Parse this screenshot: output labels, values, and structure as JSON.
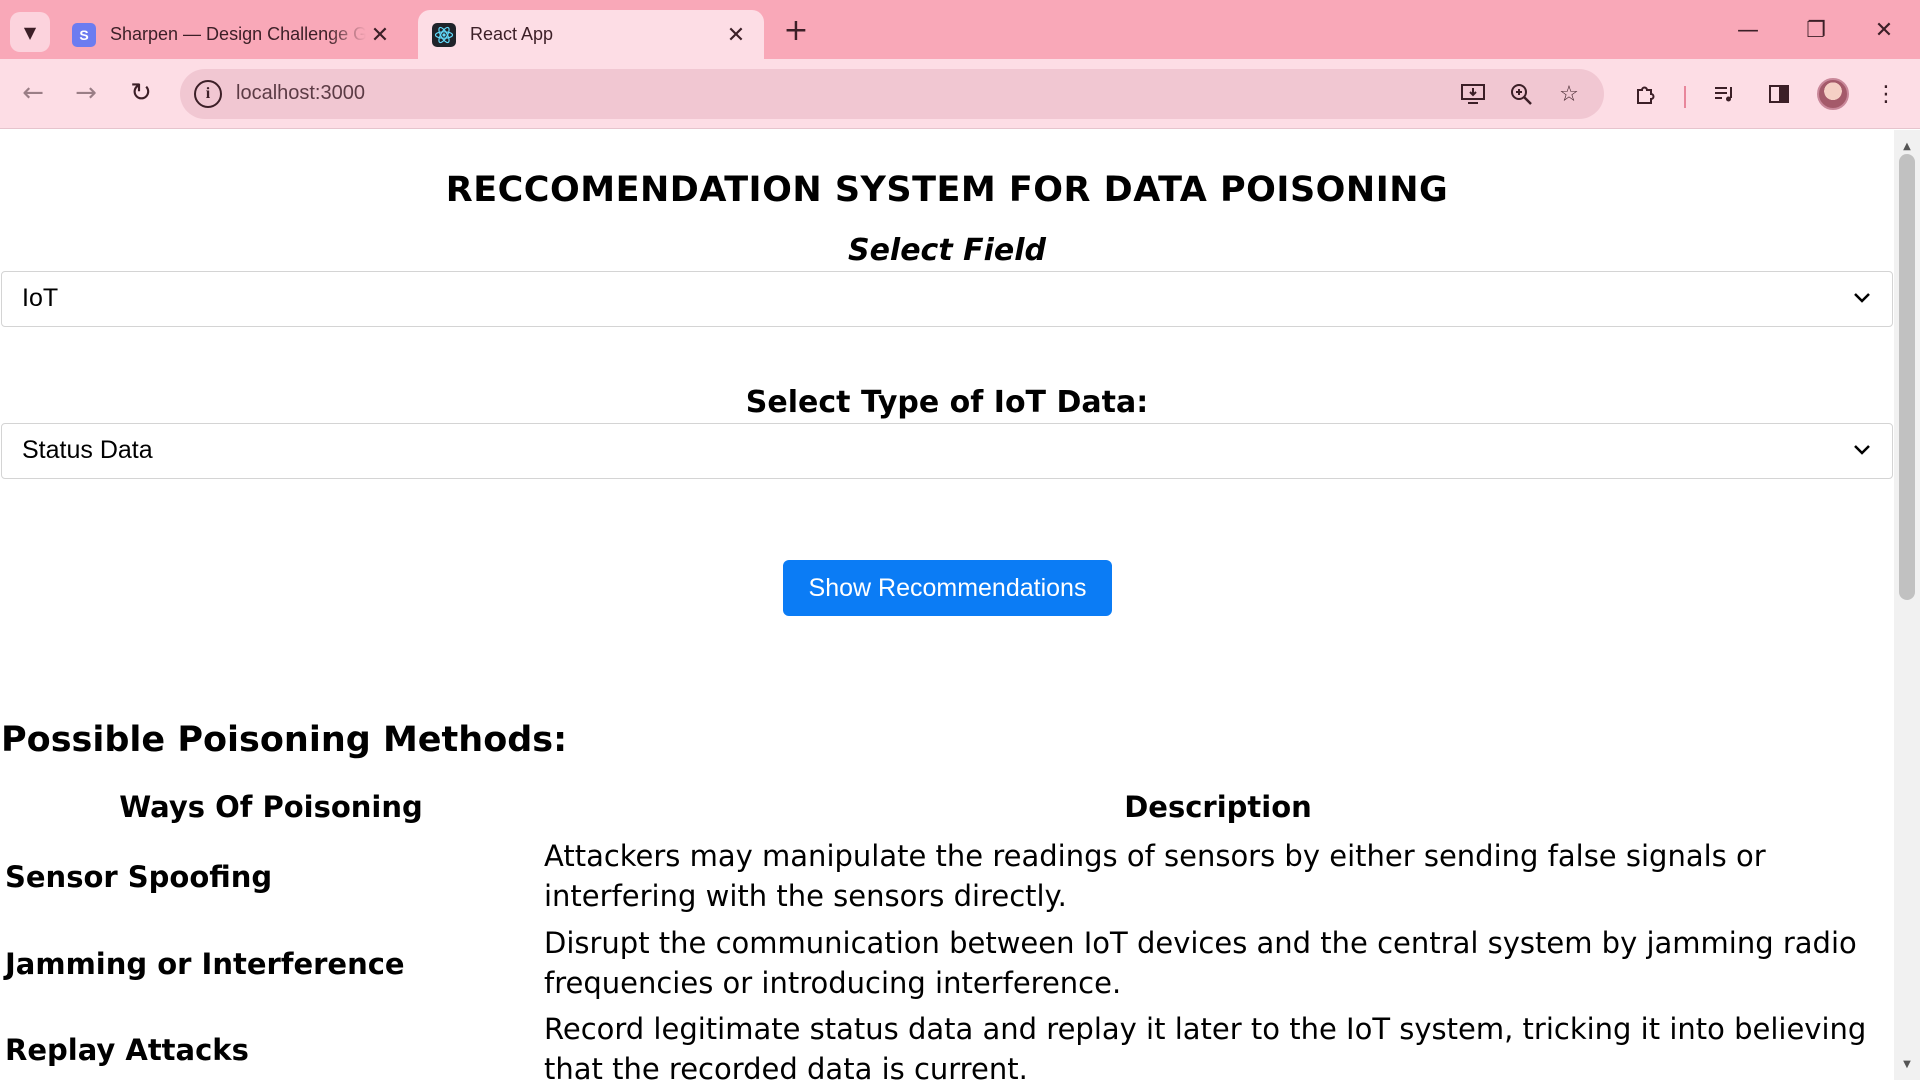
{
  "browser": {
    "tabs": [
      {
        "title": "Sharpen — Design Challenge Generator",
        "active": false
      },
      {
        "title": "React App",
        "active": true
      }
    ],
    "url": "localhost:3000"
  },
  "page": {
    "title": "RECCOMENDATION SYSTEM FOR DATA POISONING",
    "select_field_label": "Select Field",
    "field_value": "IoT",
    "type_label": "Select Type of IoT Data:",
    "type_value": "Status Data",
    "button_label": "Show Recommendations",
    "methods_heading": "Possible Poisoning Methods:",
    "table": {
      "headers": [
        "Ways Of Poisoning",
        "Description"
      ],
      "rows": [
        {
          "method": "Sensor Spoofing",
          "description": "Attackers may manipulate the readings of sensors by either sending false signals or interfering with the sensors directly."
        },
        {
          "method": "Jamming or Interference",
          "description": "Disrupt the communication between IoT devices and the central system by jamming radio frequencies or introducing interference."
        },
        {
          "method": "Replay Attacks",
          "description": "Record legitimate status data and replay it later to the IoT system, tricking it into believing that the recorded data is current."
        }
      ]
    }
  },
  "colors": {
    "tabstrip": "#f9a8b8",
    "toolbar": "#fddde5",
    "button": "#0b7cf5"
  }
}
